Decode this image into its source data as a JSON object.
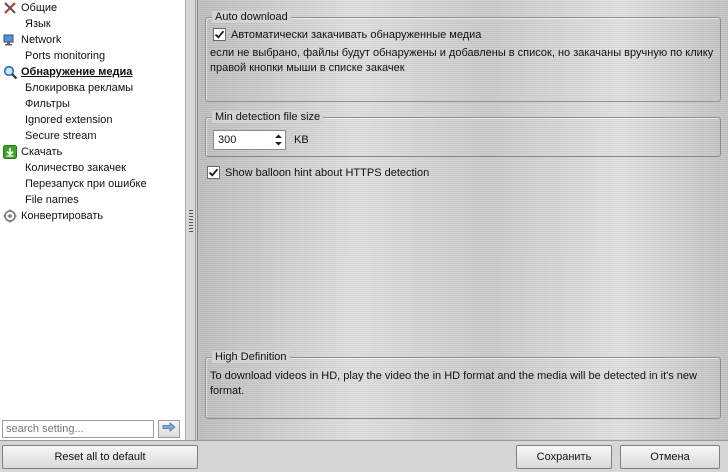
{
  "sidebar": {
    "items": [
      {
        "label": "Общие",
        "level": 0,
        "icon": "tools-icon"
      },
      {
        "label": "Язык",
        "level": 1
      },
      {
        "label": "Network",
        "level": 0,
        "icon": "network-icon"
      },
      {
        "label": "Ports monitoring",
        "level": 1
      },
      {
        "label": "Обнаружение медиа",
        "level": 0,
        "icon": "magnifier-icon",
        "selected": true
      },
      {
        "label": "Блокировка рекламы",
        "level": 1
      },
      {
        "label": "Фильтры",
        "level": 1
      },
      {
        "label": "Ignored extension",
        "level": 1
      },
      {
        "label": "Secure stream",
        "level": 1
      },
      {
        "label": "Скачать",
        "level": 0,
        "icon": "download-icon"
      },
      {
        "label": "Количество закачек",
        "level": 1
      },
      {
        "label": "Перезапуск при ошибке",
        "level": 1
      },
      {
        "label": "File names",
        "level": 1
      },
      {
        "label": "Конвертировать",
        "level": 0,
        "icon": "convert-icon"
      }
    ],
    "search_placeholder": "search setting...",
    "reset_label": "Reset all to default"
  },
  "auto_download": {
    "title": "Auto download",
    "checkbox_label": "Автоматически закачивать обнаруженные медиа",
    "checked": true,
    "description": "если не выбрано, файлы будут обнаружены и добавлены в список, но закачаны вручную по клику правой кнопки мыши в списке закачек"
  },
  "min_size": {
    "title": "Min detection file size",
    "value": "300",
    "unit": "KB"
  },
  "balloon": {
    "label": "Show balloon hint about HTTPS detection",
    "checked": true
  },
  "high_definition": {
    "title": "High Definition",
    "description": "To download videos in HD, play the video the in HD format and the media will be detected in it's new format."
  },
  "footer": {
    "save_label": "Сохранить",
    "cancel_label": "Отмена"
  },
  "colors": {
    "check_mark": "#1a1a1a",
    "download_icon": "#3aa52c",
    "magnifier_icon": "#2a6fb8",
    "tools_icon": "#c0392b"
  }
}
